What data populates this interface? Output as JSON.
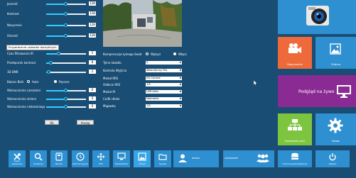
{
  "sliders": [
    {
      "label": "Jasność",
      "value": "128",
      "level": 0.5
    },
    {
      "label": "Kontrast",
      "value": "128",
      "level": 0.5
    },
    {
      "label": "Nasycenie",
      "value": "128",
      "level": 0.5
    },
    {
      "label": "Ostrość",
      "value": "128",
      "level": 0.5
    }
  ],
  "tooltip": "Przywrócenie ustawień domyślnych",
  "filter_label": "Czas filtrowania IR",
  "filter_value": "5",
  "gain_label": "Przełącznik kontrast",
  "gain_value": "8",
  "dnr_label": "3D DNR",
  "dnr_value": "2",
  "wb_label": "Balans Bieli",
  "wb_auto": "Auto",
  "wb_manual": "Ręczne",
  "gains": [
    {
      "label": "Wzmocnienie czerwieni",
      "value": "0"
    },
    {
      "label": "Wzmocnienie zieleni",
      "value": "0"
    },
    {
      "label": "Wzmocnienie niebieskiego",
      "value": "0"
    }
  ],
  "ok_label": "Ok",
  "cancel_label": "Anuluj",
  "backlight": {
    "label": "Kompensacja tylnego świat",
    "opt1": "Wyłącz",
    "opt2": "Włącz"
  },
  "settings": [
    {
      "label": "Tylne światło",
      "value": "0"
    },
    {
      "label": "Kontrola Wyjścia",
      "value": "Wewnętrzny PAL"
    },
    {
      "label": "Tryb BLC",
      "value": ""
    },
    {
      "label": "Moduł IRIS",
      "value": "Iris Control"
    },
    {
      "label": "Odbicie IRIS",
      "value": "1/5"
    },
    {
      "label": "Shutter",
      "value": "1/5"
    },
    {
      "label": "Moduł IR",
      "value": "LDR Auto"
    },
    {
      "label": "Co/Bi→Kolor",
      "value": "Normalna"
    },
    {
      "label": "Migawka",
      "value": "1/5"
    }
  ],
  "tiles": {
    "recordings": "Nagrywanie",
    "photos": "Zdjęcia",
    "live": "Podgląd na żywo",
    "network": "Ustawienia sieci",
    "settings": "Ustaw."
  },
  "toolbar": [
    {
      "name": "recording-settings",
      "label": "Kopia zapasowa",
      "icon": "tools-icon"
    },
    {
      "name": "search",
      "label": "Szukanie",
      "icon": "search-icon"
    },
    {
      "name": "storage",
      "label": "Nośnik",
      "icon": "storage-icon"
    },
    {
      "name": "schedule",
      "label": "Harmonogram",
      "icon": "clock-icon"
    },
    {
      "name": "ptz",
      "label": "PTZ",
      "icon": "ptz-icon"
    },
    {
      "name": "display",
      "label": "Wyświetlacz",
      "icon": "monitor-icon"
    },
    {
      "name": "image",
      "label": "Obraz",
      "icon": "image-icon"
    },
    {
      "name": "device",
      "label": "Serwer",
      "icon": "folder-icon"
    }
  ],
  "user_admin": "admin",
  "user_manager": "użytkownik",
  "storage_label": "Informacje/zarządzanie",
  "power_label": "Wyłącz",
  "colors": {
    "bg": "#1a4d73",
    "tile_blue": "#2e8fd1",
    "tile_orange": "#ef6a3b",
    "tile_purple": "#8a2a93",
    "tile_green": "#7ec53f",
    "accent": "#33ccff"
  }
}
